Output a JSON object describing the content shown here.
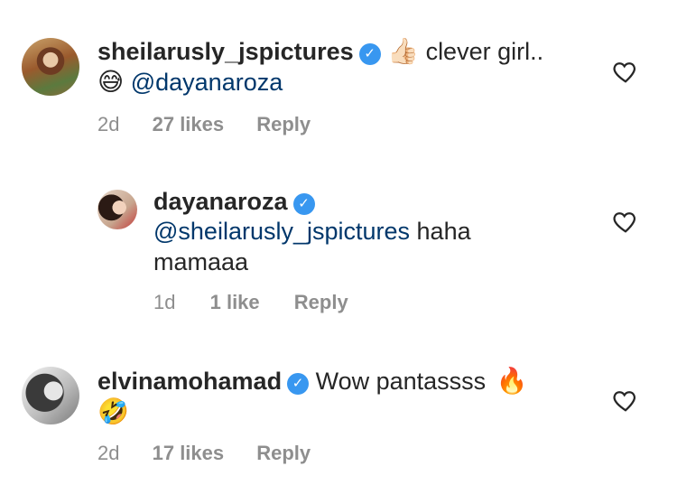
{
  "comments": [
    {
      "username": "sheilarusly_jspictures",
      "verified": true,
      "emoji_thumbs": "👍🏻",
      "text": "clever girl..",
      "emoji_sweat": "😅",
      "mention": "@dayanaroza",
      "age": "2d",
      "likes": "27 likes",
      "reply": "Reply"
    },
    {
      "username": "dayanaroza",
      "verified": true,
      "mention": "@sheilarusly_jspictures",
      "text": "haha",
      "text2": "mamaaa",
      "age": "1d",
      "likes": "1 like",
      "reply": "Reply"
    },
    {
      "username": "elvinamohamad",
      "verified": true,
      "text": "Wow pantassss",
      "emoji_fire": "🔥",
      "emoji_rofl": "🤣",
      "age": "2d",
      "likes": "17 likes",
      "reply": "Reply"
    }
  ],
  "icons": {
    "verified_badge": "verified-badge-icon",
    "like": "heart-icon"
  },
  "colors": {
    "mention": "#00376b",
    "verified": "#3897f0",
    "meta": "#8e8e8e"
  }
}
